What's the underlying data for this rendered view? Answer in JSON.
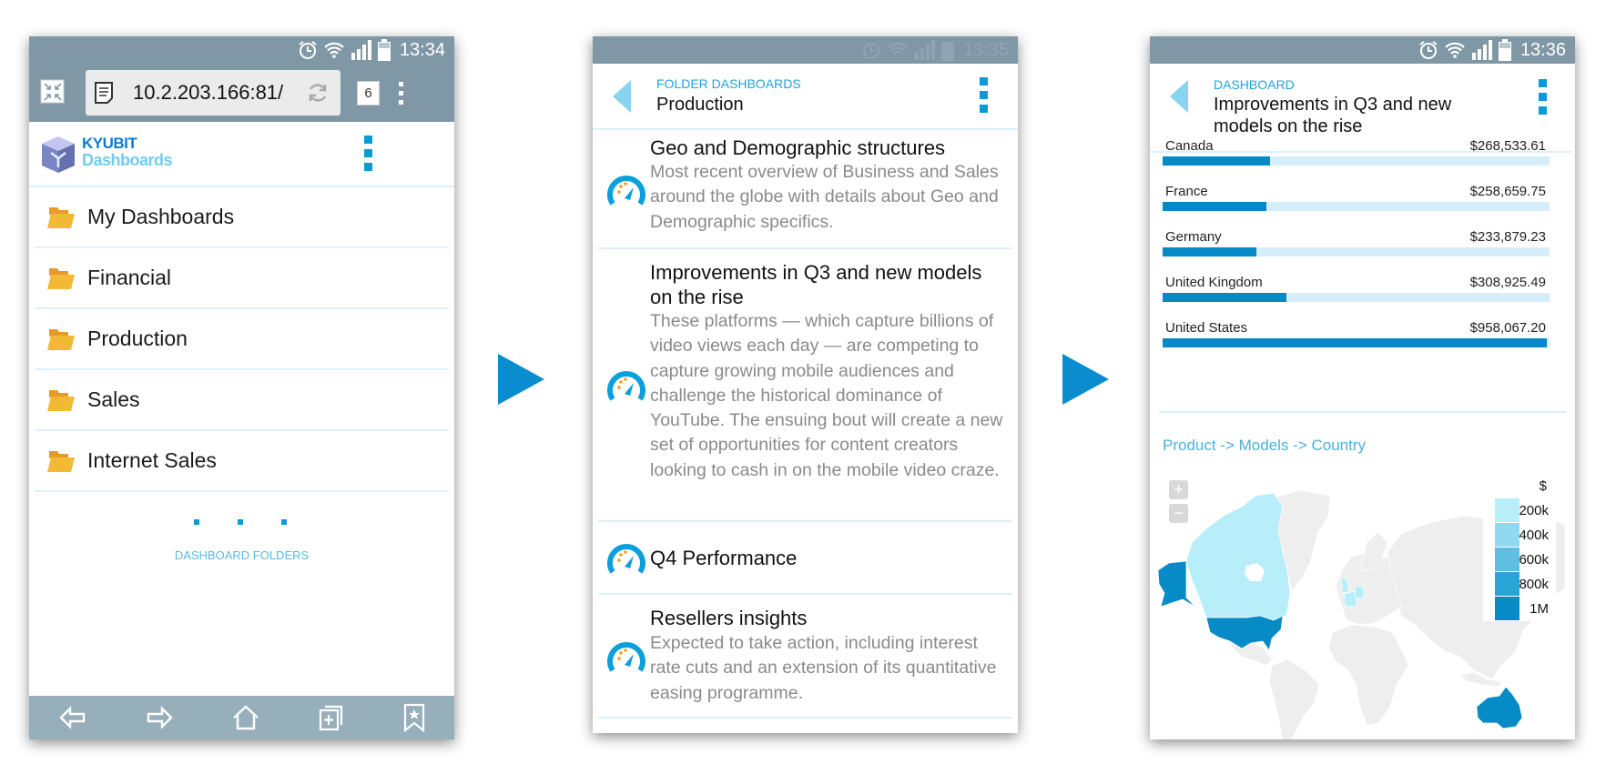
{
  "colors": {
    "accent": "#0a9ad8",
    "bar": "#0689c7",
    "bar_track": "#d5eef9",
    "status_bar": "#8098a6",
    "bottom_nav": "#97aebb",
    "folder": "#f2b935"
  },
  "screen1": {
    "status": {
      "time": "13:34",
      "icons": [
        "alarm-icon",
        "wifi-icon",
        "signal-icon",
        "battery-icon"
      ]
    },
    "browser": {
      "url": "10.2.203.166:81/",
      "tab_count": "6"
    },
    "logo": {
      "line1": "KYUBIT",
      "line2": "Dashboards"
    },
    "folders": [
      {
        "label": "My Dashboards"
      },
      {
        "label": "Financial"
      },
      {
        "label": "Production"
      },
      {
        "label": "Sales"
      },
      {
        "label": "Internet Sales"
      }
    ],
    "section_label": "DASHBOARD FOLDERS",
    "bottom_nav": [
      "back-icon",
      "forward-icon",
      "home-icon",
      "new-tab-icon",
      "bookmark-icon"
    ]
  },
  "screen2": {
    "status": {
      "time": "13:35"
    },
    "breadcrumb": "FOLDER DASHBOARDS",
    "title": "Production",
    "dashboards": [
      {
        "title": "Geo and Demographic structures",
        "description": "Most recent overview of Business and Sales around the globe with details about Geo and Demographic specifics."
      },
      {
        "title": "Improvements in Q3 and new models on the rise",
        "description": "These platforms — which capture billions of video views each day — are competing to capture growing mobile audiences and challenge the historical dominance of YouTube. The ensuing bout will create a new set of opportunities for content creators looking to cash in on the mobile video craze."
      },
      {
        "title": "Q4 Performance",
        "description": ""
      },
      {
        "title": "Resellers insights",
        "description": "Expected to take action, including interest rate cuts and an extension of its quantitative easing programme."
      }
    ]
  },
  "screen3": {
    "status": {
      "time": "13:36"
    },
    "breadcrumb": "DASHBOARD",
    "title": "Improvements in Q3 and new models on the rise",
    "map_title": "Product -> Models -> Country",
    "legend_unit": "$",
    "legend": [
      {
        "label": "200k",
        "color": "#b7eefa"
      },
      {
        "label": "400k",
        "color": "#8fdaf1"
      },
      {
        "label": "600k",
        "color": "#5ebfe3"
      },
      {
        "label": "800k",
        "color": "#2aa3d6"
      },
      {
        "label": "1M",
        "color": "#068bc7"
      }
    ]
  },
  "chart_data": [
    {
      "type": "bar",
      "orientation": "horizontal",
      "categories": [
        "Canada",
        "France",
        "Germany",
        "United Kingdom",
        "United States"
      ],
      "values": [
        268533.61,
        258659.75,
        233879.23,
        308925.49,
        958067.2
      ],
      "value_labels": [
        "$268,533.61",
        "$258,659.75",
        "$233,879.23",
        "$308,925.49",
        "$958,067.20"
      ]
    },
    {
      "type": "heatmap",
      "subtype": "choropleth-world",
      "title": "Product -> Models -> Country",
      "scale": [
        "200k",
        "400k",
        "600k",
        "800k",
        "1M"
      ],
      "highlighted": {
        "United States": "1M",
        "Australia": "1M",
        "Canada": "200k",
        "United Kingdom": "200k",
        "France": "200k",
        "Germany": "200k"
      }
    }
  ]
}
